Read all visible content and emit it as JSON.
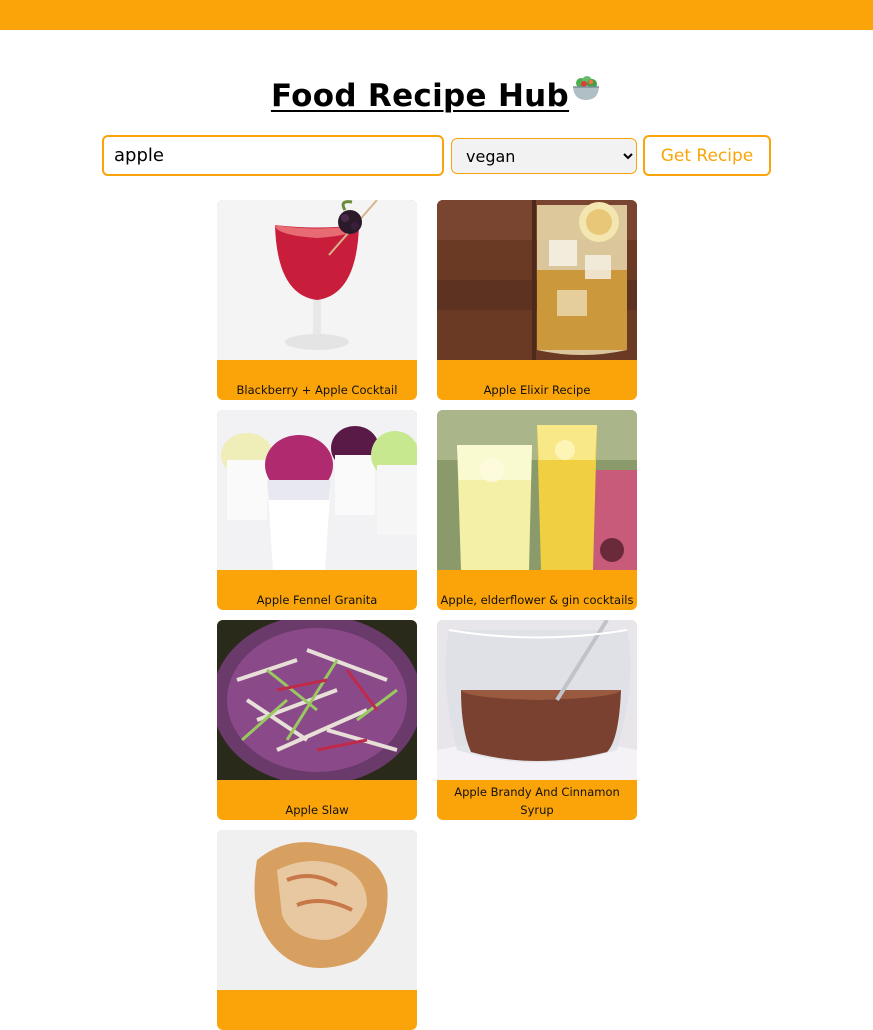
{
  "header": {
    "title": "Food Recipe Hub",
    "title_icon": "salad-icon",
    "accent_color": "#fba409"
  },
  "search": {
    "value": "apple",
    "diet_selected": "vegan",
    "button_label": "Get Recipe"
  },
  "recipes": [
    {
      "label": "Blackberry + Apple Cocktail",
      "image": "red cocktail garnished with blackberry"
    },
    {
      "label": "Apple Elixir Recipe",
      "image": "iced apple drink in tall glass"
    },
    {
      "label": "Apple Fennel Granita",
      "image": "shaved ice granita cups"
    },
    {
      "label": "Apple, elderflower & gin cocktails",
      "image": "glasses of elderflower cocktail"
    },
    {
      "label": "Apple Slaw",
      "image": "bowl of purple cabbage slaw"
    },
    {
      "label": "Apple Brandy And Cinnamon Syrup",
      "image": "pitcher of brown syrup"
    },
    {
      "label": "",
      "image": "baked apple pastry"
    }
  ]
}
